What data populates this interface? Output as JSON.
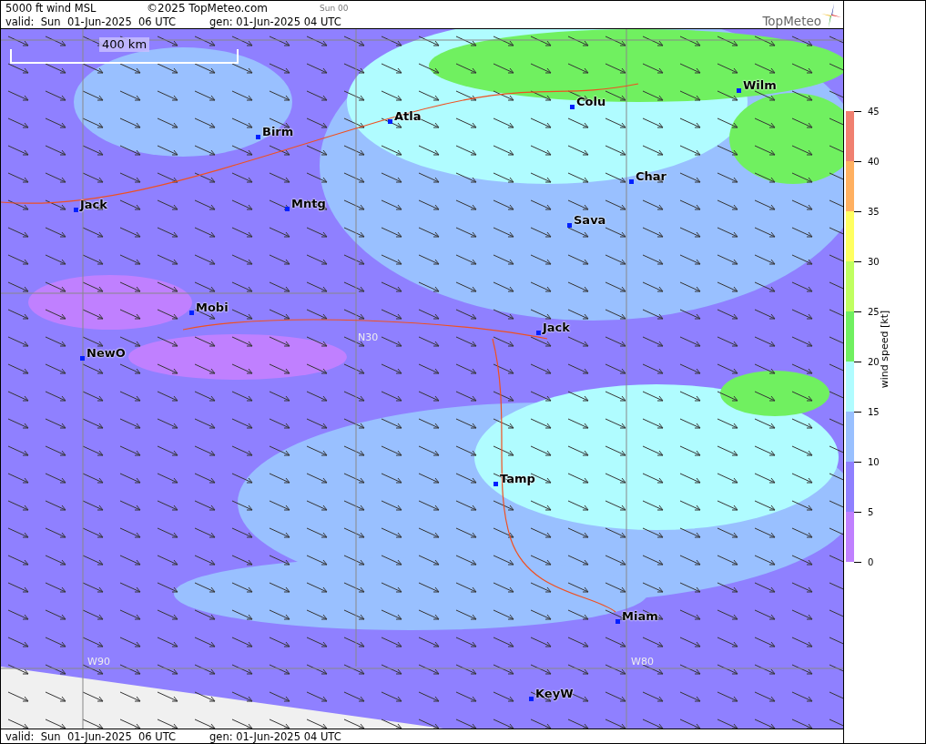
{
  "header": {
    "title": "5000 ft wind MSL",
    "copyright": "©2025 TopMeteo.com",
    "run": "Sun 00",
    "valid": "valid:  Sun  01-Jun-2025  06 UTC",
    "generated": "gen: 01-Jun-2025 04 UTC",
    "logo": "TopMeteo"
  },
  "map": {
    "scale": "400 km",
    "cities": [
      {
        "name": "Wilm"
      },
      {
        "name": "Colu"
      },
      {
        "name": "Atla"
      },
      {
        "name": "Birm"
      },
      {
        "name": "Char"
      },
      {
        "name": "Jack"
      },
      {
        "name": "Mntg"
      },
      {
        "name": "Sava"
      },
      {
        "name": "Mobi"
      },
      {
        "name": "Jack"
      },
      {
        "name": "NewO"
      },
      {
        "name": "Tamp"
      },
      {
        "name": "Miam"
      },
      {
        "name": "KeyW"
      }
    ],
    "grid_labels": [
      "N30",
      "W90",
      "W80"
    ]
  },
  "legend": {
    "title": "wind speed [kt]",
    "ticks": [
      "45",
      "40",
      "35",
      "30",
      "25",
      "20",
      "15",
      "10",
      "5",
      "0"
    ],
    "bands": [
      {
        "color": "#f08070"
      },
      {
        "color": "#ffb060"
      },
      {
        "color": "#ffff60"
      },
      {
        "color": "#c0ff60"
      },
      {
        "color": "#70f060"
      },
      {
        "color": "#b0fcff"
      },
      {
        "color": "#99c0ff"
      },
      {
        "color": "#8f80ff"
      },
      {
        "color": "#c080ff"
      }
    ]
  },
  "footer": {
    "valid": "valid:  Sun  01-Jun-2025  06 UTC",
    "generated": "gen: 01-Jun-2025 04 UTC"
  }
}
